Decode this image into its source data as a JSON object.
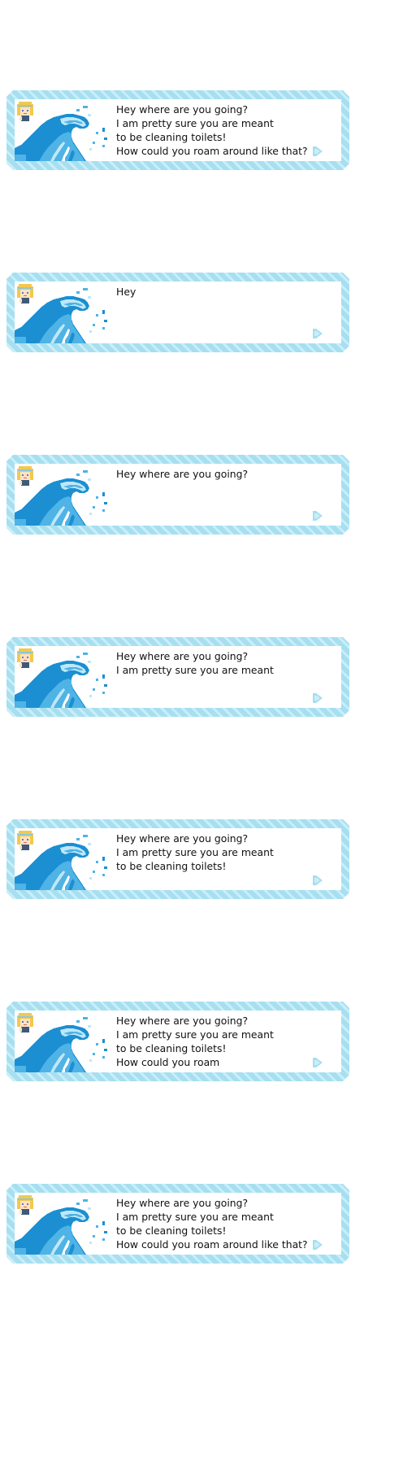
{
  "dialog_frames": [
    {
      "lines": [
        "Hey where are you going?",
        "I am pretty sure you are meant",
        "to be cleaning toilets!",
        "How could you roam around like that?"
      ]
    },
    {
      "lines": [
        "Hey",
        "",
        "",
        ""
      ]
    },
    {
      "lines": [
        "Hey where are you going?",
        "",
        "",
        ""
      ]
    },
    {
      "lines": [
        "Hey where are you going?",
        "I am pretty sure you are meant",
        "",
        ""
      ]
    },
    {
      "lines": [
        "Hey where are you going?",
        "I am pretty sure you are meant",
        "to be cleaning toilets!",
        ""
      ]
    },
    {
      "lines": [
        "Hey where are you going?",
        "I am pretty sure you are meant",
        "to be cleaning toilets!",
        "How could you roam"
      ]
    },
    {
      "lines": [
        "Hey where are you going?",
        "I am pretty sure you are meant",
        "to be cleaning toilets!",
        "How could you roam around like that?"
      ]
    }
  ],
  "icons": {
    "portrait": "wave-icon",
    "speaker": "avatar-icon",
    "continue": "continue-arrow-icon"
  },
  "colors": {
    "frame": "#a6dff0",
    "frame_stripe": "#c9eef9",
    "wave_dark": "#1b8fd2",
    "wave_mid": "#4fb3e6",
    "wave_light": "#bfe7f7",
    "arrow": "#a6dff0",
    "text": "#111111"
  }
}
